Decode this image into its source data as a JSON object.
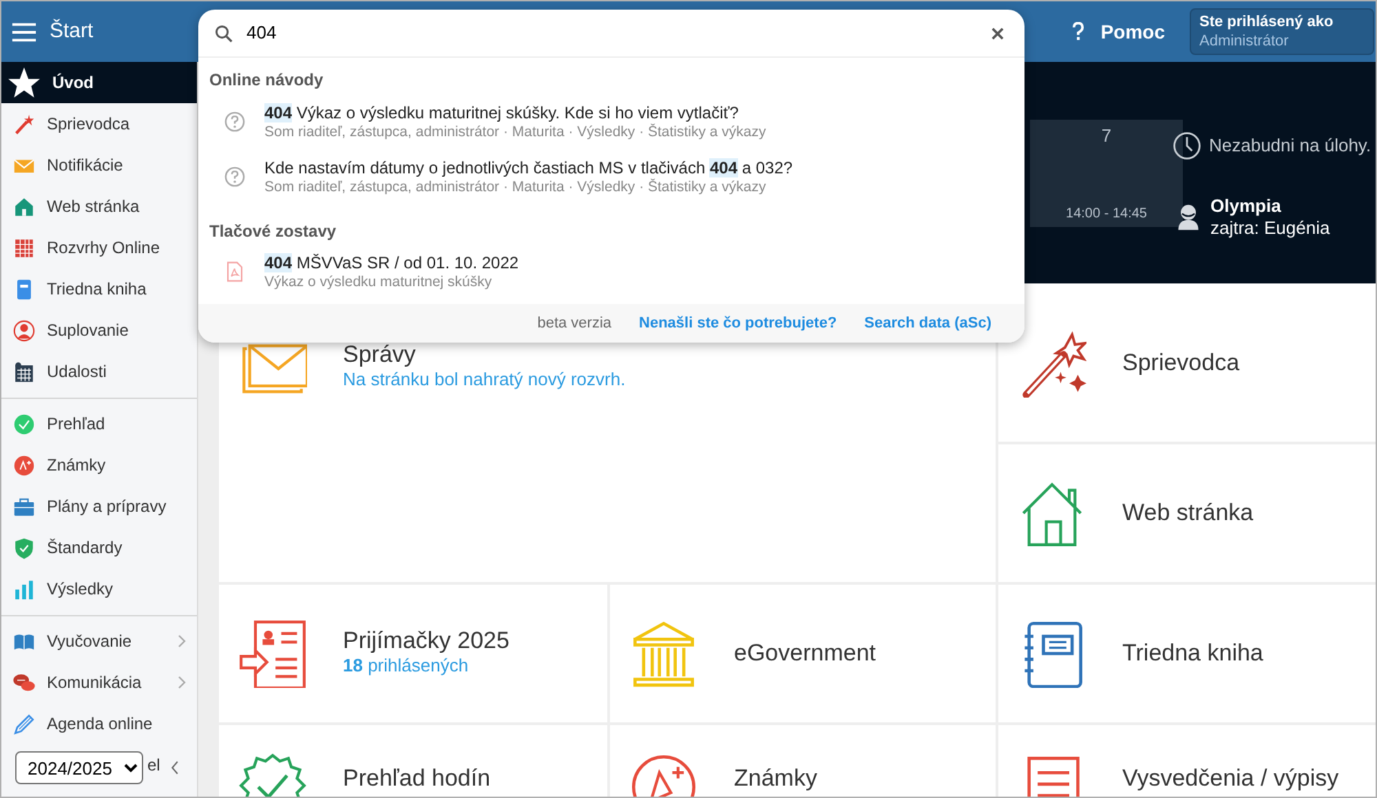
{
  "topbar": {
    "menu_label": "Štart",
    "help": "Pomoc",
    "user_caption": "Ste prihlásený ako",
    "user_role": "Administrátor"
  },
  "sidebar": {
    "groups": [
      {
        "items": [
          {
            "label": "Úvod",
            "selected": true,
            "has_submenu": false
          },
          {
            "label": "Sprievodca",
            "selected": false,
            "has_submenu": false
          },
          {
            "label": "Notifikácie",
            "selected": false,
            "has_submenu": false
          },
          {
            "label": "Web stránka",
            "selected": false,
            "has_submenu": false
          },
          {
            "label": "Rozvrhy Online",
            "selected": false,
            "has_submenu": false
          },
          {
            "label": "Triedna kniha",
            "selected": false,
            "has_submenu": false
          },
          {
            "label": "Suplovanie",
            "selected": false,
            "has_submenu": false
          },
          {
            "label": "Udalosti",
            "selected": false,
            "has_submenu": false
          }
        ]
      },
      {
        "items": [
          {
            "label": "Prehľad",
            "selected": false,
            "has_submenu": false
          },
          {
            "label": "Známky",
            "selected": false,
            "has_submenu": false
          },
          {
            "label": "Plány a prípravy",
            "selected": false,
            "has_submenu": false
          },
          {
            "label": "Štandardy",
            "selected": false,
            "has_submenu": false
          },
          {
            "label": "Výsledky",
            "selected": false,
            "has_submenu": false
          }
        ]
      },
      {
        "items": [
          {
            "label": "Vyučovanie",
            "selected": false,
            "has_submenu": true
          },
          {
            "label": "Komunikácia",
            "selected": false,
            "has_submenu": true
          },
          {
            "label": "Agenda online",
            "selected": false,
            "has_submenu": false
          }
        ]
      }
    ],
    "footer": {
      "year": "2024/2025",
      "partial_label": "el"
    }
  },
  "search": {
    "value": "404",
    "sections": [
      {
        "title": "Online návody",
        "kind": "guide",
        "results": [
          {
            "title": "**404** Výkaz o výsledku maturitnej skúšky. Kde si ho viem vytlačiť?",
            "meta": "Som riaditeľ, zástupca, administrátor · Maturita · Výsledky · Štatistiky a výkazy"
          },
          {
            "title": "Kde nastavím dátumy o jednotlivých častiach MS v tlačivách **404** a 032?",
            "meta": "Som riaditeľ, zástupca, administrátor · Maturita · Výsledky · Štatistiky a výkazy"
          }
        ]
      },
      {
        "title": "Tlačové zostavy",
        "kind": "report",
        "results": [
          {
            "title": "**404** MŠVVaS SR / od 01. 10. 2022",
            "meta": "Výkaz o výsledku maturitnej skúšky"
          }
        ]
      }
    ],
    "footer": {
      "note": "beta verzia",
      "links": [
        "Nenašli ste čo potrebujete?",
        "Search data (aSc)"
      ]
    }
  },
  "timetable_cell": {
    "period": "7",
    "time": "14:00 - 14:45"
  },
  "reminder": "Nezabudni na úlohy.",
  "nameday": {
    "today": "Olympia",
    "tomorrow": "zajtra: Eugénia"
  },
  "tiles": [
    {
      "title": "Správy",
      "subtitle": "Na stránku bol nahratý nový rozvrh."
    },
    {
      "title": "Sprievodca"
    },
    {
      "title": "Web stránka"
    },
    {
      "title": "Prijímačky 2025",
      "subtitle": "**18** prihlásených"
    },
    {
      "title": "eGovernment"
    },
    {
      "title": "Triedna kniha"
    },
    {
      "title": "Prehľad hodín"
    },
    {
      "title": "Známky"
    },
    {
      "title": "Vysvedčenia / výpisy"
    }
  ]
}
